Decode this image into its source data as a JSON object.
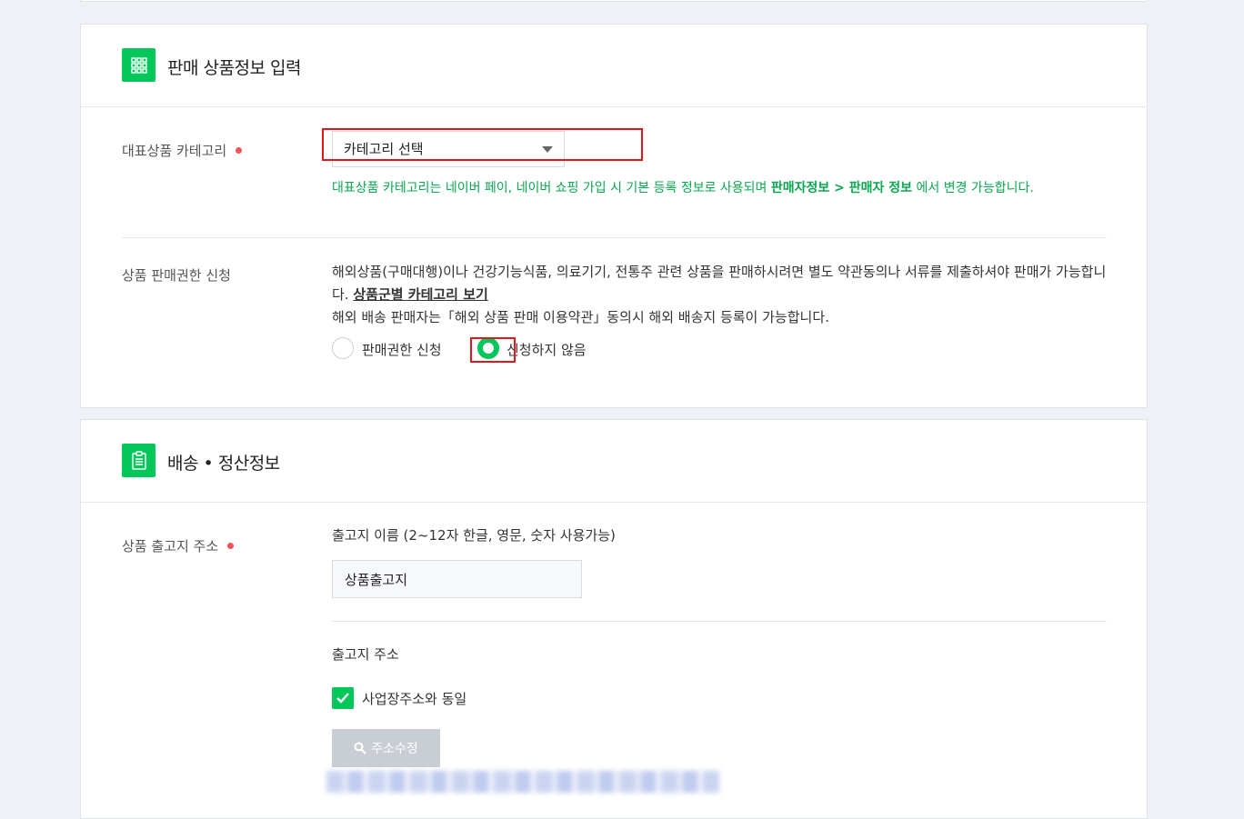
{
  "section_product": {
    "title": "판매 상품정보 입력",
    "icon": "grid-icon",
    "category_label": "대표상품 카테고리",
    "category_select_value": "카테고리 선택",
    "category_note_prefix": "대표상품 카테고리는 네이버 페이, 네이버 쇼핑 가입 시 기본 등록 정보로 사용되며 ",
    "category_note_bold": "판매자정보 > 판매자 정보",
    "category_note_suffix": " 에서 변경 가능합니다.",
    "permission_label": "상품 판매권한 신청",
    "permission_desc_1": "해외상품(구매대행)이나 건강기능식품, 의료기기, 전통주 관련 상품을 판매하시려면 별도 약관동의나 서류를 제출하셔야 판매가 가능합니다. ",
    "permission_link": "상품군별 카테고리 보기",
    "permission_desc_2": "해외 배송 판매자는「해외 상품 판매 이용약관」동의시 해외 배송지 등록이 가능합니다.",
    "radio_apply_label": "판매권한 신청",
    "radio_no_apply_label": "신청하지 않음",
    "selected_radio": "신청하지 않음"
  },
  "section_shipping": {
    "title": "배송 • 정산정보",
    "icon": "clipboard-icon",
    "warehouse_label": "상품 출고지 주소",
    "warehouse_name_label": "출고지 이름 (2~12자 한글, 영문, 숫자 사용가능)",
    "warehouse_name_value": "상품출고지",
    "warehouse_address_label": "출고지 주소",
    "same_as_business_label": "사업장주소와 동일",
    "same_as_business_checked": true,
    "edit_address_button": "주소수정"
  },
  "colors": {
    "accent": "#03c75a",
    "required_dot": "#f0525b",
    "note_green": "#0aa84f",
    "highlight_red": "#e3161b"
  }
}
